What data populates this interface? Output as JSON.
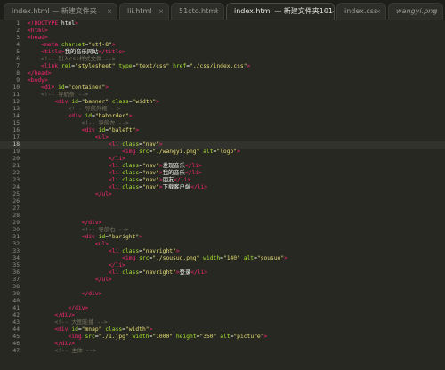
{
  "tabs": [
    {
      "label": "index.html — 新建文件夹",
      "active": false,
      "italic": false
    },
    {
      "label": "lii.html",
      "active": false,
      "italic": false
    },
    {
      "label": "51cto.html",
      "active": false,
      "italic": false
    },
    {
      "label": "index.html — 新建文件夹1014",
      "active": true,
      "italic": false
    },
    {
      "label": "index.css",
      "active": false,
      "italic": false
    },
    {
      "label": "wangyi.png",
      "active": false,
      "italic": true
    }
  ],
  "tab_close_glyph": "×",
  "current_line": 18,
  "colors": {
    "background": "#272822",
    "tag": "#f92672",
    "attribute": "#a6e22e",
    "string": "#e6db74",
    "comment": "#75715e",
    "text": "#f8f8f2",
    "gutter": "#8f908a"
  },
  "lines": [
    {
      "n": "1",
      "tokens": [
        [
          "tag",
          "<!DOCTYPE "
        ],
        [
          "txt",
          "html"
        ],
        [
          "tag",
          ">"
        ]
      ]
    },
    {
      "n": "2",
      "tokens": [
        [
          "tag",
          "<html>"
        ]
      ]
    },
    {
      "n": "3",
      "tokens": [
        [
          "tag",
          "<head>"
        ]
      ]
    },
    {
      "n": "4",
      "tokens": [
        [
          "txt",
          "    "
        ],
        [
          "tag",
          "<meta "
        ],
        [
          "attr",
          "charset"
        ],
        [
          "txt",
          "="
        ],
        [
          "str",
          "\"utf-8\""
        ],
        [
          "tag",
          ">"
        ]
      ]
    },
    {
      "n": "5",
      "tokens": [
        [
          "txt",
          "    "
        ],
        [
          "tag",
          "<title>"
        ],
        [
          "txt",
          "我的音乐网站"
        ],
        [
          "tag",
          "</title>"
        ]
      ]
    },
    {
      "n": "6",
      "tokens": [
        [
          "txt",
          "    "
        ],
        [
          "cmt",
          "<!-- 引入css样式文件 -->"
        ]
      ]
    },
    {
      "n": "7",
      "tokens": [
        [
          "txt",
          "    "
        ],
        [
          "tag",
          "<link "
        ],
        [
          "attr",
          "rel"
        ],
        [
          "txt",
          "="
        ],
        [
          "str",
          "\"stylesheet\""
        ],
        [
          "txt",
          " "
        ],
        [
          "attr",
          "type"
        ],
        [
          "txt",
          "="
        ],
        [
          "str",
          "\"text/css\""
        ],
        [
          "txt",
          " "
        ],
        [
          "attr",
          "href"
        ],
        [
          "txt",
          "="
        ],
        [
          "str",
          "\"./css/index.css\""
        ],
        [
          "tag",
          ">"
        ]
      ]
    },
    {
      "n": "8",
      "tokens": [
        [
          "tag",
          "</head>"
        ]
      ]
    },
    {
      "n": "9",
      "tokens": [
        [
          "tag",
          "<body>"
        ]
      ]
    },
    {
      "n": "10",
      "tokens": [
        [
          "txt",
          "    "
        ],
        [
          "tag",
          "<div "
        ],
        [
          "attr",
          "id"
        ],
        [
          "txt",
          "="
        ],
        [
          "str",
          "\"container\""
        ],
        [
          "tag",
          ">"
        ]
      ]
    },
    {
      "n": "11",
      "tokens": [
        [
          "txt",
          "    "
        ],
        [
          "cmt",
          "<!-- 导航条 -->"
        ]
      ]
    },
    {
      "n": "12",
      "tokens": [
        [
          "txt",
          "        "
        ],
        [
          "tag",
          "<div "
        ],
        [
          "attr",
          "id"
        ],
        [
          "txt",
          "="
        ],
        [
          "str",
          "\"banner\""
        ],
        [
          "txt",
          " "
        ],
        [
          "attr",
          "class"
        ],
        [
          "txt",
          "="
        ],
        [
          "str",
          "\"width\""
        ],
        [
          "tag",
          ">"
        ]
      ]
    },
    {
      "n": "13",
      "tokens": [
        [
          "txt",
          "            "
        ],
        [
          "cmt",
          "<!-- 导航外框 -->"
        ]
      ]
    },
    {
      "n": "14",
      "tokens": [
        [
          "txt",
          "            "
        ],
        [
          "tag",
          "<div "
        ],
        [
          "attr",
          "id"
        ],
        [
          "txt",
          "="
        ],
        [
          "str",
          "\"baborder\""
        ],
        [
          "tag",
          ">"
        ]
      ]
    },
    {
      "n": "15",
      "tokens": [
        [
          "txt",
          "                "
        ],
        [
          "cmt",
          "<!-- 导航左 -->"
        ]
      ]
    },
    {
      "n": "16",
      "tokens": [
        [
          "txt",
          "                "
        ],
        [
          "tag",
          "<div "
        ],
        [
          "attr",
          "id"
        ],
        [
          "txt",
          "="
        ],
        [
          "str",
          "\"baleft\""
        ],
        [
          "tag",
          ">"
        ]
      ]
    },
    {
      "n": "17",
      "tokens": [
        [
          "txt",
          "                    "
        ],
        [
          "tag",
          "<ul>"
        ]
      ]
    },
    {
      "n": "18",
      "tokens": [
        [
          "txt",
          "                        "
        ],
        [
          "tag",
          "<li "
        ],
        [
          "attr",
          "class"
        ],
        [
          "txt",
          "="
        ],
        [
          "str",
          "\"nav\""
        ],
        [
          "tag",
          ">"
        ]
      ]
    },
    {
      "n": "19",
      "tokens": [
        [
          "txt",
          "                            "
        ],
        [
          "tag",
          "<img "
        ],
        [
          "attr",
          "src"
        ],
        [
          "txt",
          "="
        ],
        [
          "str",
          "\"./wangyi.png\""
        ],
        [
          "txt",
          " "
        ],
        [
          "attr",
          "alt"
        ],
        [
          "txt",
          "="
        ],
        [
          "str",
          "\"logo\""
        ],
        [
          "tag",
          ">"
        ]
      ]
    },
    {
      "n": "20",
      "tokens": [
        [
          "txt",
          "                        "
        ],
        [
          "tag",
          "</li>"
        ]
      ]
    },
    {
      "n": "21",
      "tokens": [
        [
          "txt",
          "                        "
        ],
        [
          "tag",
          "<li "
        ],
        [
          "attr",
          "class"
        ],
        [
          "txt",
          "="
        ],
        [
          "str",
          "\"nav\""
        ],
        [
          "tag",
          ">"
        ],
        [
          "txt",
          "发现音乐"
        ],
        [
          "tag",
          "</li>"
        ]
      ]
    },
    {
      "n": "22",
      "tokens": [
        [
          "txt",
          "                        "
        ],
        [
          "tag",
          "<li "
        ],
        [
          "attr",
          "class"
        ],
        [
          "txt",
          "="
        ],
        [
          "str",
          "\"nav\""
        ],
        [
          "tag",
          ">"
        ],
        [
          "txt",
          "我的音乐"
        ],
        [
          "tag",
          "</li>"
        ]
      ]
    },
    {
      "n": "23",
      "tokens": [
        [
          "txt",
          "                        "
        ],
        [
          "tag",
          "<li "
        ],
        [
          "attr",
          "class"
        ],
        [
          "txt",
          "="
        ],
        [
          "str",
          "\"nav\""
        ],
        [
          "tag",
          ">"
        ],
        [
          "txt",
          "朋友"
        ],
        [
          "tag",
          "</li>"
        ]
      ]
    },
    {
      "n": "24",
      "tokens": [
        [
          "txt",
          "                        "
        ],
        [
          "tag",
          "<li "
        ],
        [
          "attr",
          "class"
        ],
        [
          "txt",
          "="
        ],
        [
          "str",
          "\"nav\""
        ],
        [
          "tag",
          ">"
        ],
        [
          "txt",
          "下载客户端"
        ],
        [
          "tag",
          "</li>"
        ]
      ]
    },
    {
      "n": "25",
      "tokens": [
        [
          "txt",
          "                    "
        ],
        [
          "tag",
          "</ul>"
        ]
      ]
    },
    {
      "n": "26",
      "tokens": []
    },
    {
      "n": "27",
      "tokens": []
    },
    {
      "n": "28",
      "tokens": []
    },
    {
      "n": "29",
      "tokens": [
        [
          "txt",
          "                "
        ],
        [
          "tag",
          "</div>"
        ]
      ]
    },
    {
      "n": "30",
      "tokens": [
        [
          "txt",
          "                "
        ],
        [
          "cmt",
          "<!-- 导航右 -->"
        ]
      ]
    },
    {
      "n": "31",
      "tokens": [
        [
          "txt",
          "                "
        ],
        [
          "tag",
          "<div "
        ],
        [
          "attr",
          "id"
        ],
        [
          "txt",
          "="
        ],
        [
          "str",
          "\"baright\""
        ],
        [
          "tag",
          ">"
        ]
      ]
    },
    {
      "n": "32",
      "tokens": [
        [
          "txt",
          "                    "
        ],
        [
          "tag",
          "<ul>"
        ]
      ]
    },
    {
      "n": "33",
      "tokens": [
        [
          "txt",
          "                        "
        ],
        [
          "tag",
          "<li "
        ],
        [
          "attr",
          "class"
        ],
        [
          "txt",
          "="
        ],
        [
          "str",
          "\"navright\""
        ],
        [
          "tag",
          ">"
        ]
      ]
    },
    {
      "n": "34",
      "tokens": [
        [
          "txt",
          "                            "
        ],
        [
          "tag",
          "<img "
        ],
        [
          "attr",
          "src"
        ],
        [
          "txt",
          "="
        ],
        [
          "str",
          "\"./sousuo.png\""
        ],
        [
          "txt",
          " "
        ],
        [
          "attr",
          "width"
        ],
        [
          "txt",
          "="
        ],
        [
          "str",
          "\"140\""
        ],
        [
          "txt",
          " "
        ],
        [
          "attr",
          "alt"
        ],
        [
          "txt",
          "="
        ],
        [
          "str",
          "\"sousuo\""
        ],
        [
          "tag",
          ">"
        ]
      ]
    },
    {
      "n": "35",
      "tokens": [
        [
          "txt",
          "                        "
        ],
        [
          "tag",
          "</li>"
        ]
      ]
    },
    {
      "n": "36",
      "tokens": [
        [
          "txt",
          "                        "
        ],
        [
          "tag",
          "<li "
        ],
        [
          "attr",
          "class"
        ],
        [
          "txt",
          "="
        ],
        [
          "str",
          "\"navright\""
        ],
        [
          "tag",
          ">"
        ],
        [
          "txt",
          "登录"
        ],
        [
          "tag",
          "</li>"
        ]
      ]
    },
    {
      "n": "37",
      "tokens": [
        [
          "txt",
          "                    "
        ],
        [
          "tag",
          "</ul>"
        ]
      ]
    },
    {
      "n": "38",
      "tokens": []
    },
    {
      "n": "39",
      "tokens": [
        [
          "txt",
          "                "
        ],
        [
          "tag",
          "</div>"
        ]
      ]
    },
    {
      "n": "40",
      "tokens": []
    },
    {
      "n": "41",
      "tokens": [
        [
          "txt",
          "            "
        ],
        [
          "tag",
          "</div>"
        ]
      ]
    },
    {
      "n": "42",
      "tokens": [
        [
          "txt",
          "        "
        ],
        [
          "tag",
          "</div>"
        ]
      ]
    },
    {
      "n": "43",
      "tokens": [
        [
          "txt",
          "        "
        ],
        [
          "cmt",
          "<!-- 大图轮播 -->"
        ]
      ]
    },
    {
      "n": "44",
      "tokens": [
        [
          "txt",
          "        "
        ],
        [
          "tag",
          "<div "
        ],
        [
          "attr",
          "id"
        ],
        [
          "txt",
          "="
        ],
        [
          "str",
          "\"mnap\""
        ],
        [
          "txt",
          " "
        ],
        [
          "attr",
          "class"
        ],
        [
          "txt",
          "="
        ],
        [
          "str",
          "\"width\""
        ],
        [
          "tag",
          ">"
        ]
      ]
    },
    {
      "n": "45",
      "tokens": [
        [
          "txt",
          "            "
        ],
        [
          "tag",
          "<img "
        ],
        [
          "attr",
          "src"
        ],
        [
          "txt",
          "="
        ],
        [
          "str",
          "\"./1.jpg\""
        ],
        [
          "txt",
          " "
        ],
        [
          "attr",
          "width"
        ],
        [
          "txt",
          "="
        ],
        [
          "str",
          "\"1000\""
        ],
        [
          "txt",
          " "
        ],
        [
          "attr",
          "height"
        ],
        [
          "txt",
          "="
        ],
        [
          "str",
          "\"350\""
        ],
        [
          "txt",
          " "
        ],
        [
          "attr",
          "alt"
        ],
        [
          "txt",
          "="
        ],
        [
          "str",
          "\"picture\""
        ],
        [
          "tag",
          ">"
        ]
      ]
    },
    {
      "n": "46",
      "tokens": [
        [
          "txt",
          "        "
        ],
        [
          "tag",
          "</div>"
        ]
      ]
    },
    {
      "n": "47",
      "tokens": [
        [
          "txt",
          "        "
        ],
        [
          "cmt",
          "<!-- 主体 -->"
        ]
      ]
    }
  ]
}
